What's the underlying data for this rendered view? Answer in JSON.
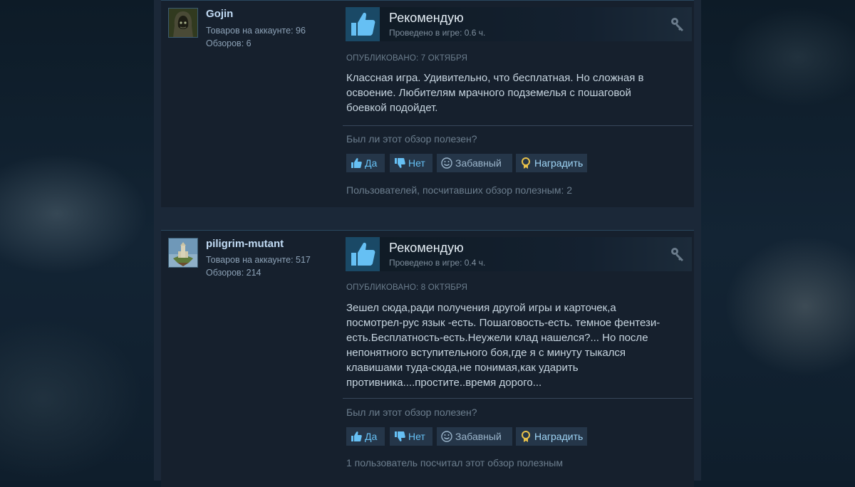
{
  "colors": {
    "page_bg": "#0e1d2b",
    "card_bg": "#16202d",
    "accent_blue": "#66c0f4",
    "username": "#c1dbf4",
    "text": "#c6d4df",
    "muted": "#6c7e8e"
  },
  "reviews": [
    {
      "author": {
        "name": "Gojin",
        "products": "Товаров на аккаунте: 96",
        "reviews": "Обзоров: 6",
        "avatar_icon": "hooded-figure-avatar"
      },
      "verdict": "Рекомендую",
      "verdict_icon": "thumbs-up-icon",
      "hours": "Проведено в игре: 0.6 ч.",
      "posted": "ОПУБЛИКОВАНО: 7 ОКТЯБРЯ",
      "text": "Классная игра. Удивительно, что бесплатная. Но сложная в\nосвоение. Любителям мрачного подземелья с пошаговой\nбоевкой подойдет.",
      "helpful_question": "Был ли этот обзор полезен?",
      "buttons": {
        "yes": "Да",
        "no": "Нет",
        "funny": "Забавный",
        "award": "Наградить"
      },
      "helpful_count": "Пользователей, посчитавших обзор полезным: 2"
    },
    {
      "author": {
        "name": "piligrim-mutant",
        "products": "Товаров на аккаунте: 517",
        "reviews": "Обзоров: 214",
        "avatar_icon": "floating-castle-avatar"
      },
      "verdict": "Рекомендую",
      "verdict_icon": "thumbs-up-icon",
      "hours": "Проведено в игре: 0.4 ч.",
      "posted": "ОПУБЛИКОВАНО: 8 ОКТЯБРЯ",
      "text": "Зешел сюда,ради получения другой игры и карточек,а\nпосмотрел-рус язык -есть. Пошаговость-есть. темное фентези-\nесть.Бесплатность-есть.Неужели клад нашелся?... Но после\nнепонятного вступительного боя,где я с минуту тыкался\nклавишами туда-сюда,не понимая,как ударить\nпротивника....простите..время дорого...",
      "helpful_question": "Был ли этот обзор полезен?",
      "buttons": {
        "yes": "Да",
        "no": "Нет",
        "funny": "Забавный",
        "award": "Наградить"
      },
      "helpful_count": "1 пользователь посчитал этот обзор полезным"
    }
  ]
}
